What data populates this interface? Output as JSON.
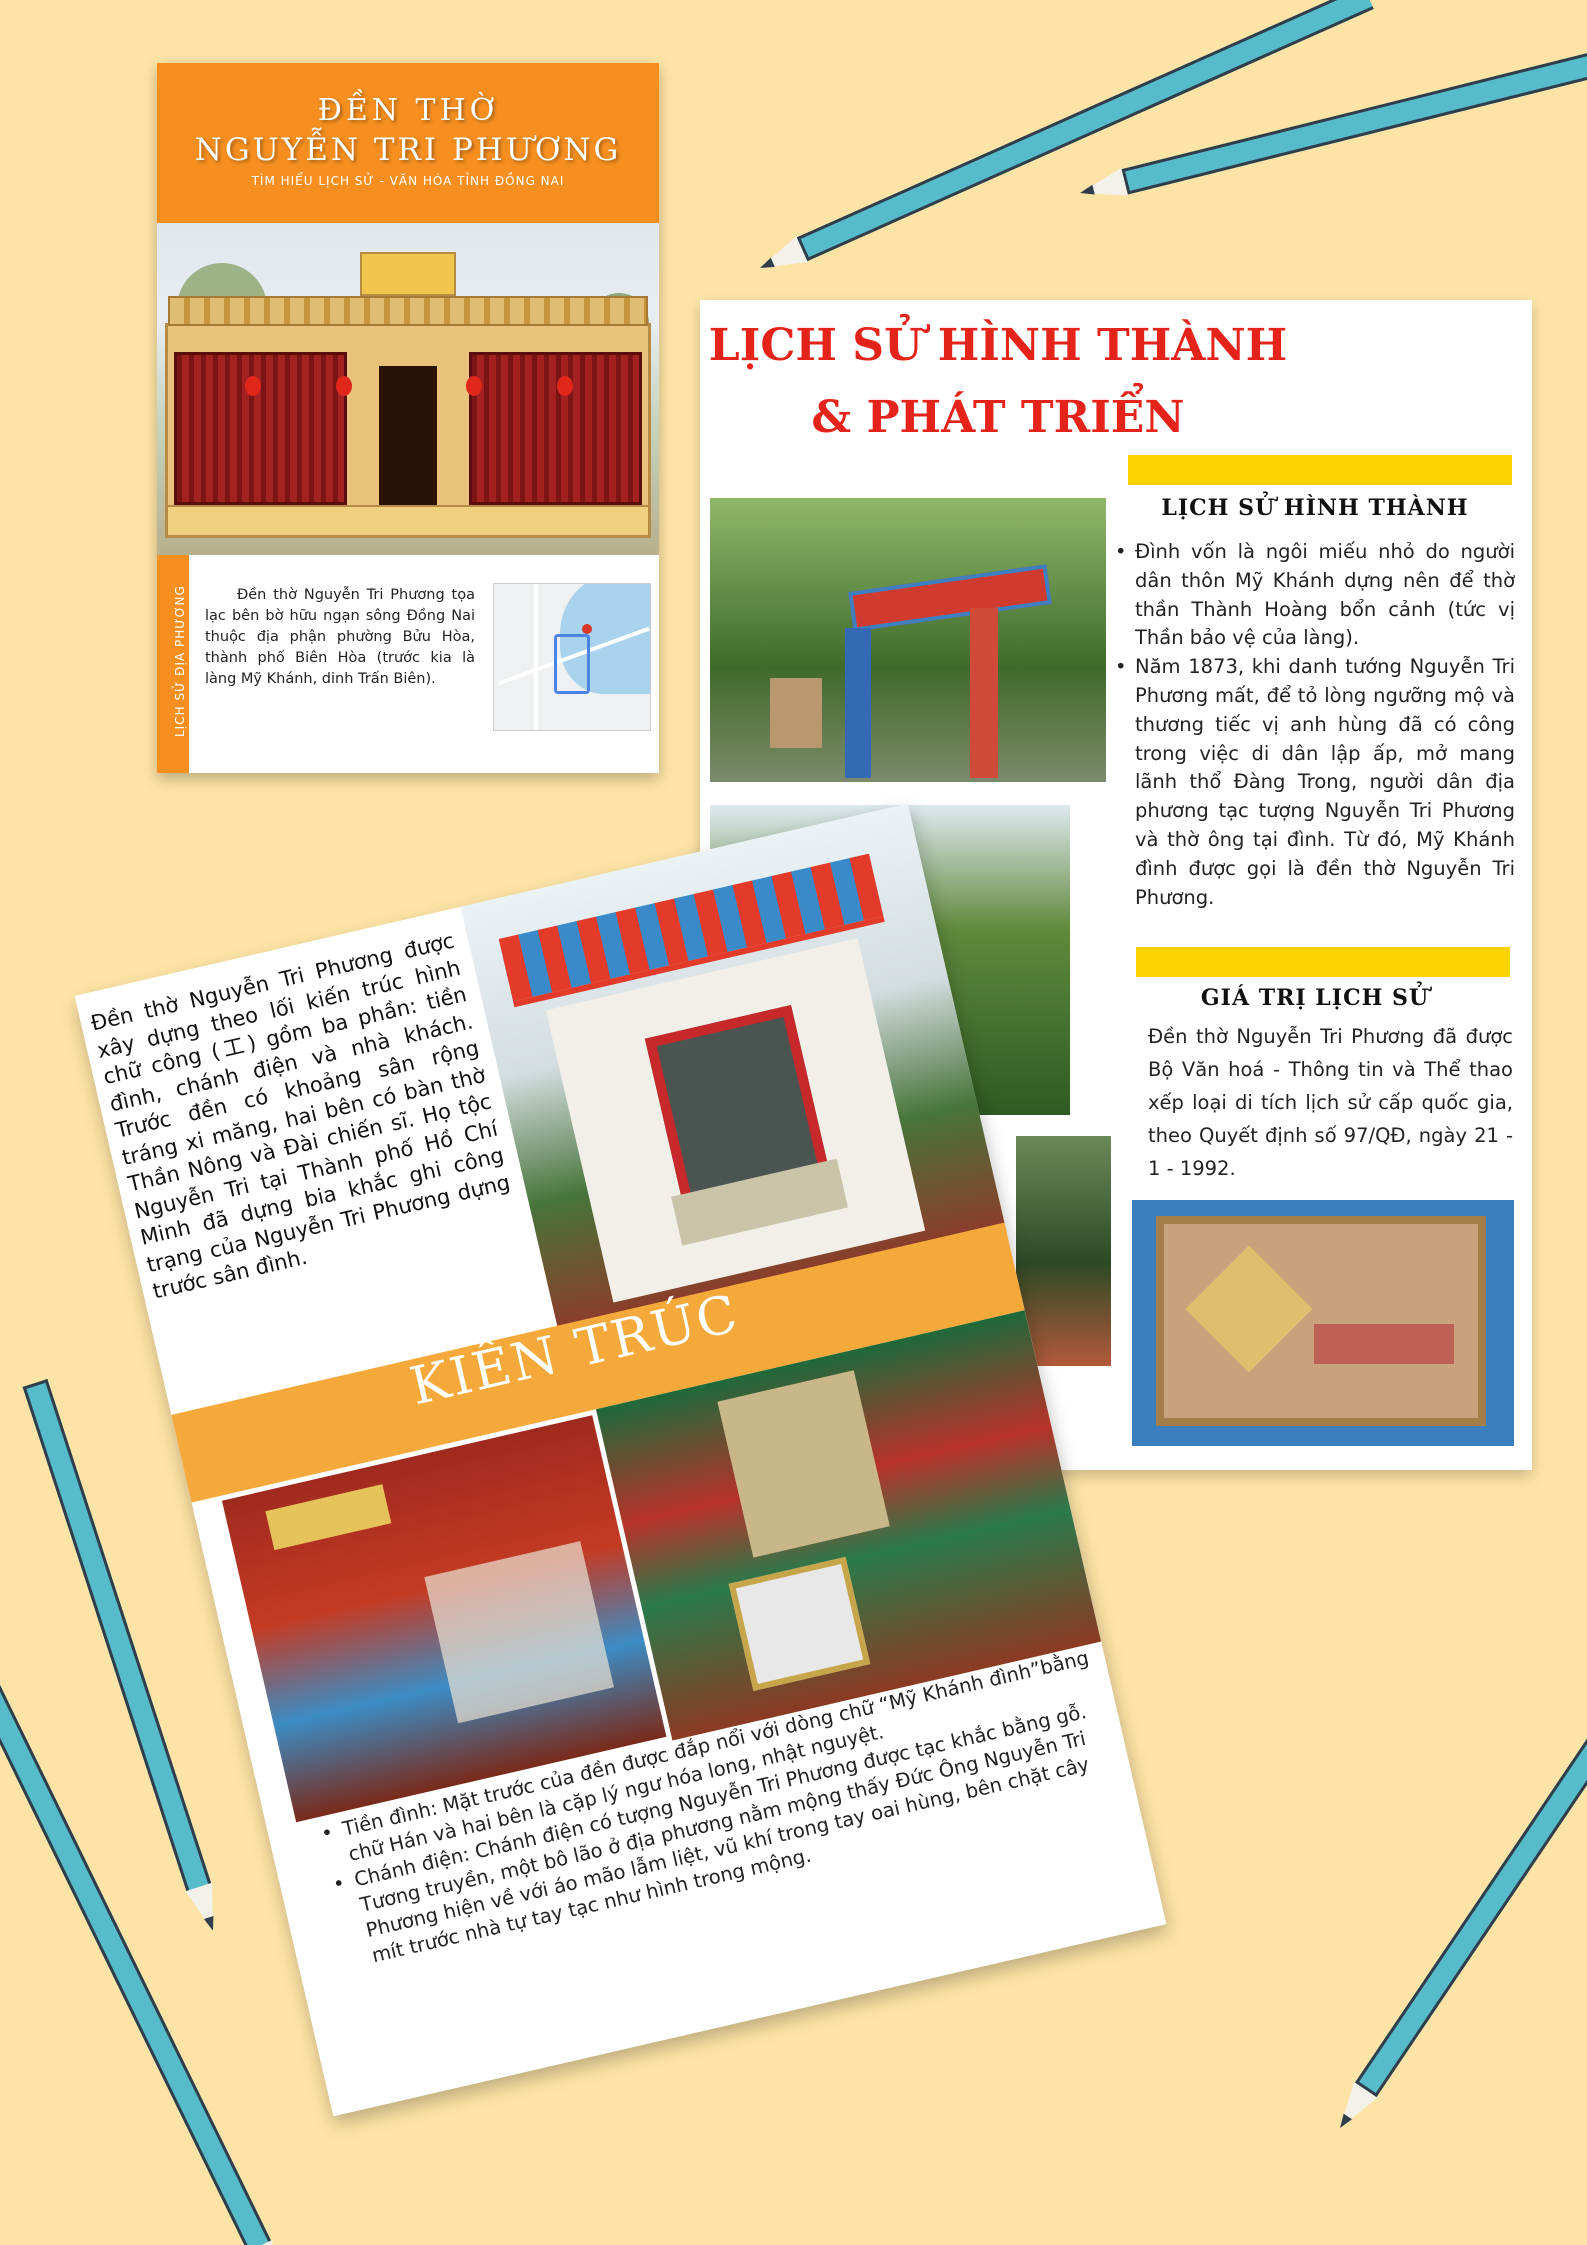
{
  "cover": {
    "title_line1": "ĐỀN THỜ",
    "title_line2": "NGUYỄN TRI PHƯƠNG",
    "subtitle": "TÌM HIỂU LỊCH SỬ - VĂN HÓA TỈNH ĐỒNG NAI",
    "side_label": "LỊCH SỬ ĐỊA PHƯƠNG",
    "intro": "Đền thờ Nguyễn Tri Phương tọa lạc bên bờ hữu ngạn sông Đồng Nai thuộc địa phận phường Bửu Hòa, thành phố Biên Hòa (trước kia là làng Mỹ Khánh, dinh Trấn Biên)."
  },
  "history": {
    "title_line1": "LỊCH SỬ HÌNH THÀNH",
    "title_line2": "& PHÁT TRIỂN",
    "section1_heading": "LỊCH SỬ HÌNH THÀNH",
    "section1_items": [
      "Đình vốn là ngôi miếu nhỏ do người dân thôn Mỹ Khánh dựng nên để thờ thần Thành Hoàng bổn cảnh (tức vị Thần bảo vệ của làng).",
      "Năm 1873, khi danh tướng Nguyễn Tri Phương mất, để tỏ lòng ngưỡng mộ và thương tiếc vị anh hùng đã có công trong việc di dân lập ấp, mở mang lãnh thổ Đàng Trong, người dân địa phương tạc tượng Nguyễn Tri Phương và thờ ông tại đình. Từ đó, Mỹ Khánh đình được gọi là đền thờ Nguyễn Tri Phương."
    ],
    "section2_heading": "GIÁ TRỊ LỊCH SỬ",
    "section2_text": "Đền thờ Nguyễn Tri Phương đã được Bộ Văn hoá - Thông tin và Thể thao xếp loại di tích lịch sử cấp quốc gia, theo Quyết định số 97/QĐ, ngày 21 - 1 - 1992."
  },
  "architecture": {
    "intro": "Đền thờ Nguyễn Tri Phương được xây dựng theo lối kiến trúc hình chữ công (工) gồm ba phần: tiền đình, chánh điện và nhà khách. Trước đền có khoảng sân rộng tráng xi măng, hai bên có bàn thờ Thần Nông và Đài chiến sĩ. Họ tộc Nguyễn Tri tại Thành phố Hồ Chí Minh đã dựng bia khắc ghi công trạng của Nguyễn Tri Phương dựng trước sân đình.",
    "heading": "KIẾN TRÚC",
    "bullets": [
      "Tiền đình: Mặt trước của đền được đắp nổi với dòng chữ “Mỹ Khánh đình”bằng chữ Hán và hai bên là cặp lý ngư hóa long, nhật nguyệt.",
      "Chánh điện: Chánh điện có tượng Nguyễn Tri Phương được tạc khắc bằng gỗ. Tương truyền, một bô lão ở địa phương nằm mộng thấy Đức Ông Nguyễn Tri Phương hiện về với áo mão lẫm liệt, vũ khí trong tay oai hùng, bên chặt cây mít trước nhà tự tay tạc như hình trong mộng."
    ]
  },
  "colors": {
    "background": "#fde4a6",
    "orange": "#f68f1f",
    "red": "#e4231a",
    "yellow": "#fbd400",
    "pencil": "#56bccb"
  },
  "icons": [
    "pencil-icon",
    "map-icon"
  ]
}
